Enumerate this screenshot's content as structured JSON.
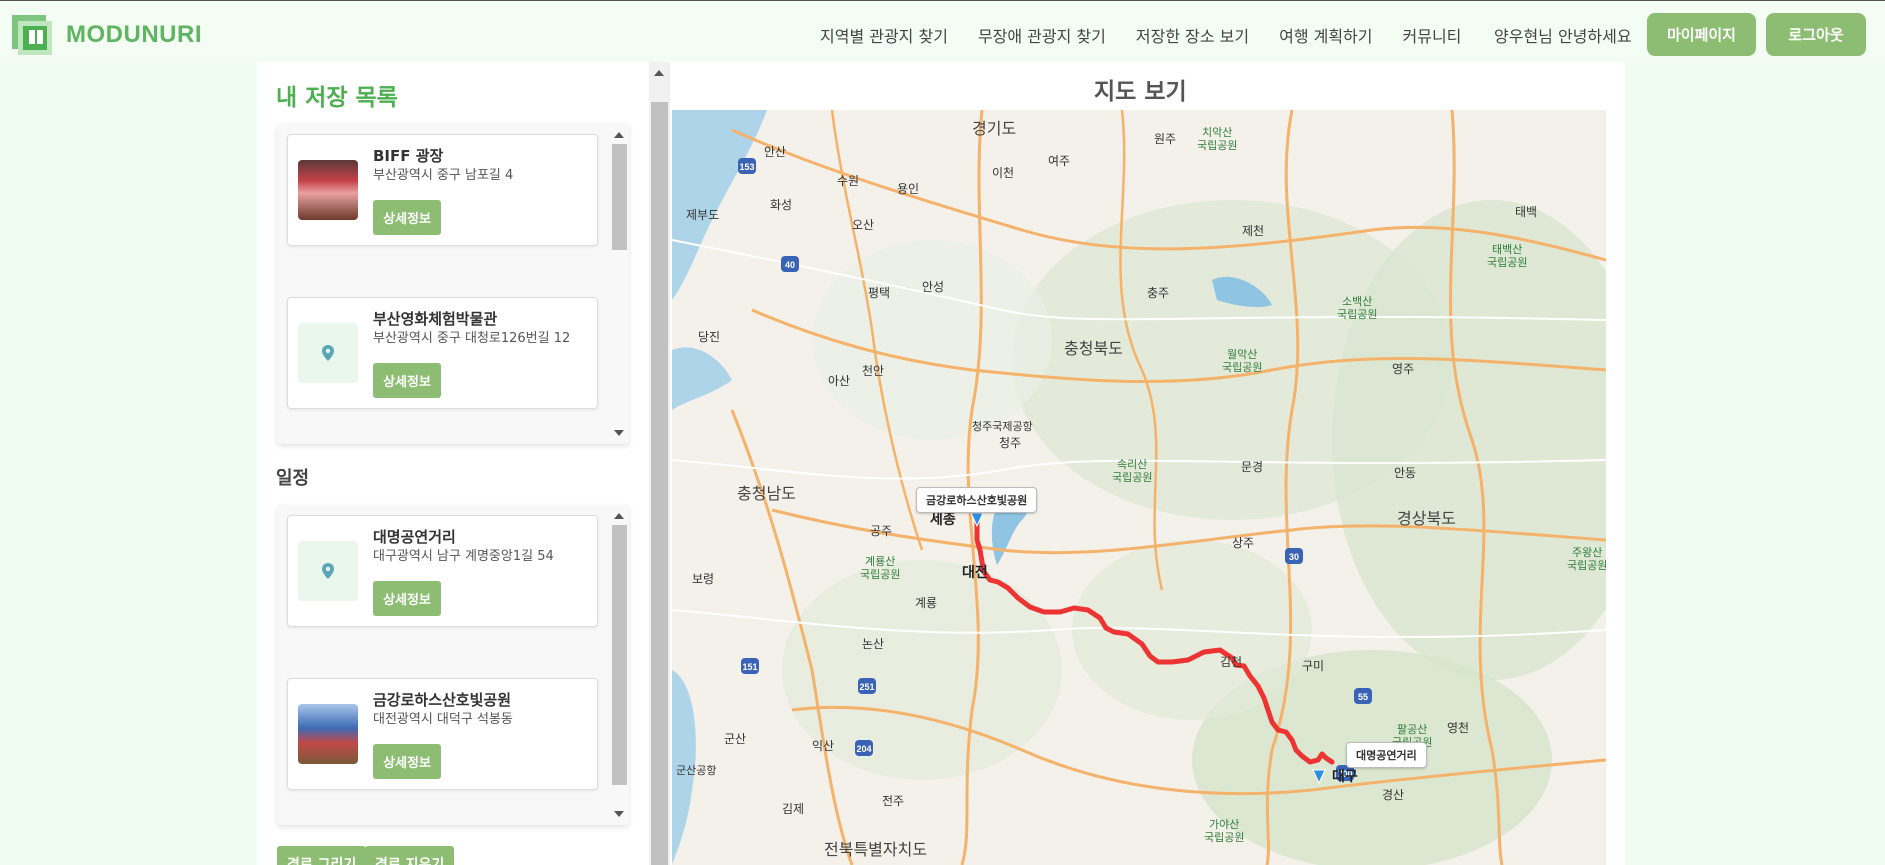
{
  "header": {
    "logo_text": "MODUNURI",
    "nav": [
      "지역별 관광지 찾기",
      "무장애 관광지 찾기",
      "저장한 장소 보기",
      "여행 계획하기",
      "커뮤니티"
    ],
    "greeting": "양우현님 안녕하세요",
    "mypage_label": "마이페이지",
    "logout_label": "로그아웃"
  },
  "saved": {
    "title": "내 저장 목록",
    "items": [
      {
        "name": "BIFF 광장",
        "address": "부산광역시 중구 남포길 4",
        "detail_label": "상세정보",
        "thumb": "photo"
      },
      {
        "name": "부산영화체험박물관",
        "address": "부산광역시 중구 대청로126번길 12",
        "detail_label": "상세정보",
        "thumb": "map-pin-icon"
      }
    ]
  },
  "schedule": {
    "title": "일정",
    "items": [
      {
        "name": "대명공연거리",
        "address": "대구광역시 남구 계명중앙1길 54",
        "detail_label": "상세정보",
        "thumb": "map-pin-icon"
      },
      {
        "name": "금강로하스산호빛공원",
        "address": "대전광역시 대덕구 석봉동",
        "detail_label": "상세정보",
        "thumb": "photo"
      }
    ]
  },
  "actions": {
    "draw_route_label": "경로 그리기",
    "clear_route_label": "경로 지우기"
  },
  "map": {
    "title": "지도 보기",
    "start_label": "금강로하스산호빛공원",
    "end_label": "대명공연거리",
    "route_color": "#ee3333",
    "regions": [
      "경기도",
      "충청북도",
      "충청남도",
      "경상북도",
      "전북특별자치도"
    ],
    "cities": [
      "안산",
      "수원",
      "용인",
      "이천",
      "여주",
      "원주",
      "화성",
      "오산",
      "제천",
      "태백",
      "평택",
      "안성",
      "충주",
      "당진",
      "아산",
      "천안",
      "영주",
      "청주",
      "문경",
      "안동",
      "세종",
      "공주",
      "대전",
      "상주",
      "보령",
      "계룡",
      "논산",
      "김천",
      "구미",
      "영천",
      "군산",
      "익산",
      "대구",
      "경산",
      "김제",
      "전주",
      "제부도",
      "청주국제공항",
      "군산공항"
    ],
    "parks": [
      "치악산\n국립공원",
      "태백산\n국립공원",
      "소백산\n국립공원",
      "월악산\n국립공원",
      "속리산\n국립공원",
      "계룡산\n국립공원",
      "팔공산\n국립공원",
      "가야산\n국립공원",
      "주왕산\n국립공원"
    ],
    "road_shields": [
      "153",
      "40",
      "30",
      "151",
      "251",
      "204",
      "55",
      "700"
    ]
  }
}
